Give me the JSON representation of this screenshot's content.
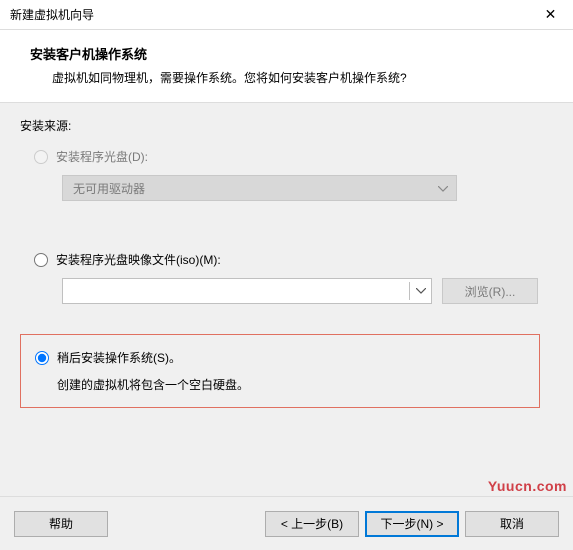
{
  "titlebar": {
    "title": "新建虚拟机向导",
    "close": "✕"
  },
  "header": {
    "title": "安装客户机操作系统",
    "subtitle": "虚拟机如同物理机，需要操作系统。您将如何安装客户机操作系统?"
  },
  "content": {
    "section_label": "安装来源:",
    "opt_disc": {
      "label": "安装程序光盘(D):",
      "dropdown": "无可用驱动器"
    },
    "opt_iso": {
      "label": "安装程序光盘映像文件(iso)(M):",
      "browse": "浏览(R)..."
    },
    "opt_later": {
      "label": "稍后安装操作系统(S)。",
      "hint": "创建的虚拟机将包含一个空白硬盘。"
    }
  },
  "footer": {
    "help": "帮助",
    "back": "< 上一步(B)",
    "next": "下一步(N) >",
    "cancel": "取消"
  },
  "watermark": "Yuucn.com"
}
